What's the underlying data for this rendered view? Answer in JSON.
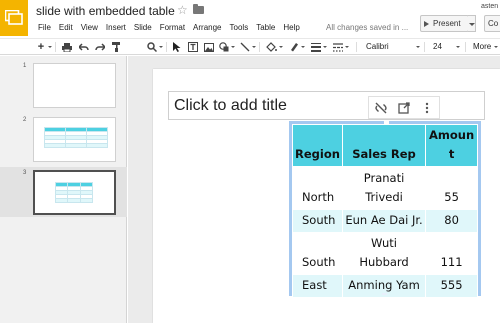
{
  "app": {
    "doc_title": "slide with embedded table",
    "user_name": "asten",
    "brand_color": "#f4b400"
  },
  "menu": [
    "File",
    "Edit",
    "View",
    "Insert",
    "Slide",
    "Format",
    "Arrange",
    "Tools",
    "Table",
    "Help"
  ],
  "status": {
    "save_text": "All changes saved in ..."
  },
  "buttons": {
    "present_label": "Present",
    "comments_label": "Co"
  },
  "toolbar": {
    "font": "Calibri",
    "font_size": "24",
    "more_label": "More",
    "icons": [
      "add-icon",
      "print-icon",
      "undo-icon",
      "redo-icon",
      "paint-format-icon",
      "zoom-icon",
      "select-icon",
      "text-box-icon",
      "image-icon",
      "shape-icon",
      "line-icon",
      "fill-color-icon",
      "border-color-icon",
      "border-weight-icon",
      "border-dash-icon"
    ]
  },
  "filmstrip": {
    "slides": [
      {
        "number": "1",
        "selected": false,
        "has_table": false
      },
      {
        "number": "2",
        "selected": false,
        "has_table": true
      },
      {
        "number": "3",
        "selected": true,
        "has_table": true
      }
    ]
  },
  "slide": {
    "title_placeholder": "Click to add title",
    "floating_toolbar_icons": [
      "unlink-icon",
      "open-link-icon",
      "more-vert-icon"
    ]
  },
  "table": {
    "header_color": "#4dd0e1",
    "alt_row_color": "#e0f7fa",
    "headers": {
      "region": "Region",
      "rep": "Sales Rep",
      "amount_1": "Amoun",
      "amount_2": "t"
    },
    "rows": [
      {
        "region": "North",
        "rep_1": "Pranati",
        "rep_2": "Trivedi",
        "amount": "55"
      },
      {
        "region": "South",
        "rep": "Eun Ae Dai Jr.",
        "amount": "80"
      },
      {
        "region": "South",
        "rep_1": "Wuti",
        "rep_2": "Hubbard",
        "amount": "111"
      },
      {
        "region": "East",
        "rep": "Anming Yam",
        "amount": "555"
      }
    ]
  }
}
